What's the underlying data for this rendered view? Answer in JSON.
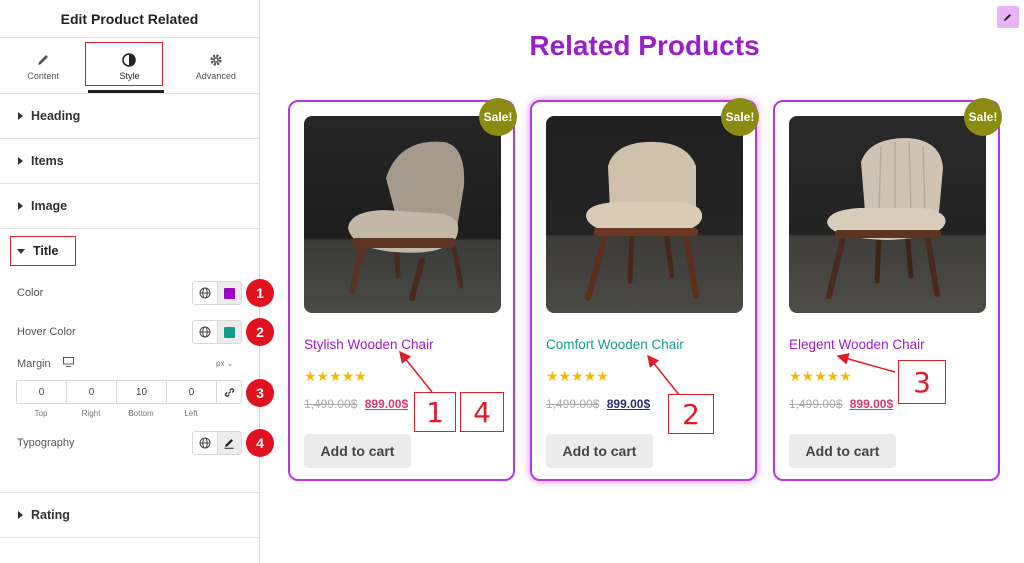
{
  "panel": {
    "title": "Edit Product Related",
    "tabs": [
      {
        "label": "Content",
        "icon": "pencil-icon"
      },
      {
        "label": "Style",
        "icon": "half-circle-icon"
      },
      {
        "label": "Advanced",
        "icon": "gear-icon"
      }
    ],
    "active_tab": "Style",
    "sections_top": [
      "Heading",
      "Items",
      "Image"
    ],
    "title_section": {
      "label": "Title",
      "color_label": "Color",
      "color_value": "#9a06c4",
      "hover_color_label": "Hover Color",
      "hover_color_value": "#139c8c",
      "margin_label": "Margin",
      "margin_unit": "px",
      "margin": {
        "top": "0",
        "right": "0",
        "bottom": "10",
        "left": "0"
      },
      "margin_sublabels": {
        "top": "Top",
        "right": "Right",
        "bottom": "Bottom",
        "left": "Left"
      },
      "typography_label": "Typography"
    },
    "sections_bottom": [
      "Rating"
    ],
    "badges": [
      "1",
      "2",
      "3",
      "4"
    ]
  },
  "preview": {
    "heading": "Related Products",
    "sale_label": "Sale!",
    "products": [
      {
        "title": "Stylish Wooden Chair",
        "old_price": "1,499.00$",
        "new_price": "899.00$",
        "rating": 5,
        "button": "Add to cart",
        "title_color": "#9a1fc7",
        "price_color": "#d63a6a"
      },
      {
        "title": "Comfort Wooden Chair",
        "old_price": "1,499.00$",
        "new_price": "899.00$",
        "rating": 5,
        "button": "Add to cart",
        "title_color": "#139c8c",
        "price_color": "#2d2d6e"
      },
      {
        "title": "Elegent Wooden Chair",
        "old_price": "1,499.00$",
        "new_price": "899.00$",
        "rating": 5,
        "button": "Add to cart",
        "title_color": "#9a1fc7",
        "price_color": "#d63a6a"
      }
    ],
    "callouts": [
      "1",
      "4",
      "2",
      "3"
    ]
  },
  "colors": {
    "accent": "#9a1fc7",
    "annotation_red": "#e01b2a",
    "sale_badge": "#8b8b12",
    "star": "#f0b90b"
  }
}
